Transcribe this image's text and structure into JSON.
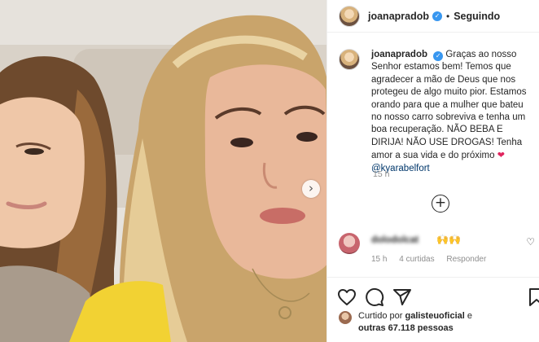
{
  "post": {
    "username": "joanapradob",
    "follow_status": "Seguindo",
    "dot": "•",
    "verified_mark": "✓"
  },
  "caption": {
    "username": "joanapradob",
    "text_before_mention": "Graças ao nosso Senhor estamos bem! Temos que agradecer a mão de Deus que nos protegeu de algo muito pior. Estamos orando para que a mulher que bateu no nosso carro sobreviva e tenha um boa recuperação. NÃO BEBA E DIRIJA! NÃO USE DROGAS! Tenha amor a sua vida e do próximo",
    "heart": "❤",
    "mention": "@kyarabelfort",
    "time": "15 h"
  },
  "load_more": {
    "symbol": "+"
  },
  "comment": {
    "username": "dolodolcat",
    "emoji": "🙌🙌",
    "time": "15 h",
    "likes": "4 curtidas",
    "reply": "Responder",
    "like_icon": "♡"
  },
  "likes": {
    "prefix": "Curtido por",
    "user": "galisteuoficial",
    "conj": "e",
    "others": "outras 67.118 pessoas"
  },
  "media": {
    "next_arrow": "›"
  },
  "icons": [
    "heart-icon",
    "comment-icon",
    "share-icon",
    "bookmark-icon",
    "add-circle-icon",
    "chevron-right-icon",
    "verified-icon"
  ]
}
